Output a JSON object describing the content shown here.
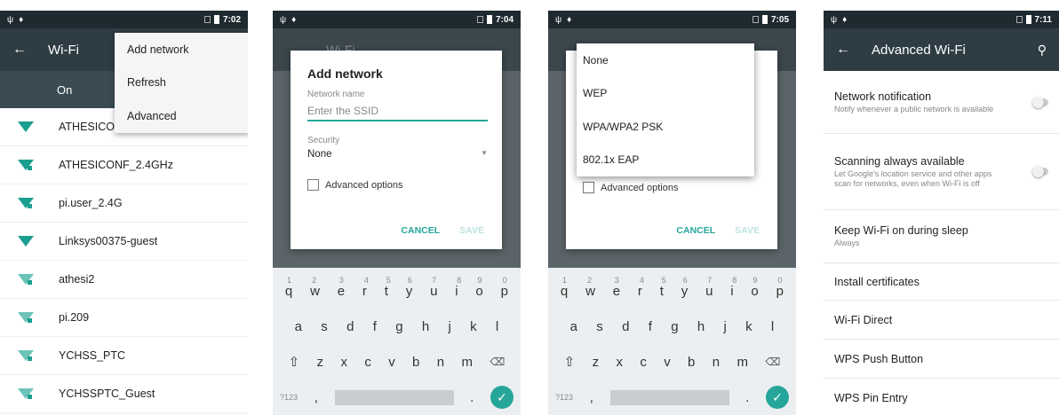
{
  "screen1": {
    "status_time": "7:02",
    "title": "Wi-Fi",
    "on_label": "On",
    "networks": [
      {
        "name": "ATHESICONF"
      },
      {
        "name": "ATHESICONF_2.4GHz"
      },
      {
        "name": "pi.user_2.4G"
      },
      {
        "name": "Linksys00375-guest"
      },
      {
        "name": "athesi2"
      },
      {
        "name": "pi.209"
      },
      {
        "name": "YCHSS_PTC"
      },
      {
        "name": "YCHSSPTC_Guest"
      }
    ],
    "menu": [
      "Add network",
      "Refresh",
      "Advanced"
    ]
  },
  "screen2": {
    "status_time": "7:04",
    "bg_title": "Wi-Fi",
    "dialog_title": "Add network",
    "network_name_label": "Network name",
    "ssid_placeholder": "Enter the SSID",
    "security_label": "Security",
    "security_value": "None",
    "advanced_options": "Advanced options",
    "cancel": "CANCEL",
    "save": "SAVE"
  },
  "screen3": {
    "status_time": "7:05",
    "security_options": [
      "None",
      "WEP",
      "WPA/WPA2 PSK",
      "802.1x EAP"
    ],
    "advanced_options": "Advanced options",
    "cancel": "CANCEL",
    "save": "SAVE"
  },
  "keyboard": {
    "row1": [
      "q",
      "w",
      "e",
      "r",
      "t",
      "y",
      "u",
      "i",
      "o",
      "p"
    ],
    "row1_nums": [
      "1",
      "2",
      "3",
      "4",
      "5",
      "6",
      "7",
      "8",
      "9",
      "0"
    ],
    "row2": [
      "a",
      "s",
      "d",
      "f",
      "g",
      "h",
      "j",
      "k",
      "l"
    ],
    "row3": [
      "z",
      "x",
      "c",
      "v",
      "b",
      "n",
      "m"
    ],
    "symbols": "?123",
    "comma": ","
  },
  "screen4": {
    "status_time": "7:11",
    "title": "Advanced Wi-Fi",
    "items": [
      {
        "title": "Network notification",
        "sub": "Notify whenever a public network is available"
      },
      {
        "title": "Scanning always available",
        "sub": "Let Google's location service and other apps scan for networks, even when Wi-Fi is off"
      },
      {
        "title": "Keep Wi-Fi on during sleep",
        "sub": "Always"
      },
      {
        "title": "Install certificates",
        "sub": ""
      },
      {
        "title": "Wi-Fi Direct",
        "sub": ""
      },
      {
        "title": "WPS Push Button",
        "sub": ""
      },
      {
        "title": "WPS Pin Entry",
        "sub": ""
      }
    ]
  },
  "colors": {
    "accent": "#26a69a",
    "appbar": "#2e3d44",
    "status": "#1e2a2f",
    "wifi_icon": "#1a9e8f"
  }
}
